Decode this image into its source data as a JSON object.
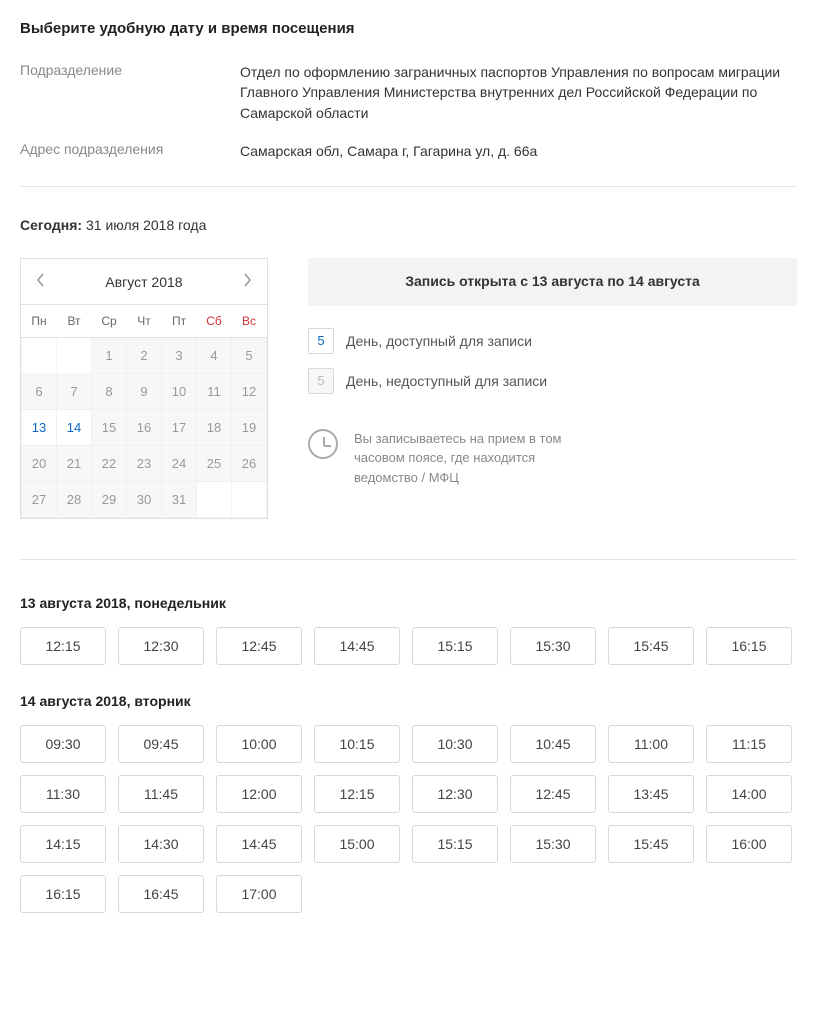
{
  "title": "Выберите удобную дату и время посещения",
  "info": {
    "dept_label": "Подразделение",
    "dept_value": "Отдел по оформлению заграничных паспортов Управления по вопросам миграции Главного Управления Министерства внутренних дел Российской Федерации по Самарской области",
    "addr_label": "Адрес подразделения",
    "addr_value": "Самарская обл, Самара г, Гагарина ул, д. 66а"
  },
  "today": {
    "label": "Сегодня:",
    "value": "31 июля 2018 года"
  },
  "calendar": {
    "month": "Август 2018",
    "weekdays": [
      "Пн",
      "Вт",
      "Ср",
      "Чт",
      "Пт",
      "Сб",
      "Вс"
    ],
    "weeks": [
      [
        {
          "d": "",
          "t": "empty"
        },
        {
          "d": "",
          "t": "empty"
        },
        {
          "d": "1",
          "t": "normal"
        },
        {
          "d": "2",
          "t": "normal"
        },
        {
          "d": "3",
          "t": "normal"
        },
        {
          "d": "4",
          "t": "normal"
        },
        {
          "d": "5",
          "t": "normal"
        }
      ],
      [
        {
          "d": "6",
          "t": "normal"
        },
        {
          "d": "7",
          "t": "normal"
        },
        {
          "d": "8",
          "t": "normal"
        },
        {
          "d": "9",
          "t": "normal"
        },
        {
          "d": "10",
          "t": "normal"
        },
        {
          "d": "11",
          "t": "normal"
        },
        {
          "d": "12",
          "t": "normal"
        }
      ],
      [
        {
          "d": "13",
          "t": "available"
        },
        {
          "d": "14",
          "t": "available"
        },
        {
          "d": "15",
          "t": "normal"
        },
        {
          "d": "16",
          "t": "normal"
        },
        {
          "d": "17",
          "t": "normal"
        },
        {
          "d": "18",
          "t": "normal"
        },
        {
          "d": "19",
          "t": "normal"
        }
      ],
      [
        {
          "d": "20",
          "t": "normal"
        },
        {
          "d": "21",
          "t": "normal"
        },
        {
          "d": "22",
          "t": "normal"
        },
        {
          "d": "23",
          "t": "normal"
        },
        {
          "d": "24",
          "t": "normal"
        },
        {
          "d": "25",
          "t": "normal"
        },
        {
          "d": "26",
          "t": "normal"
        }
      ],
      [
        {
          "d": "27",
          "t": "normal"
        },
        {
          "d": "28",
          "t": "normal"
        },
        {
          "d": "29",
          "t": "normal"
        },
        {
          "d": "30",
          "t": "normal"
        },
        {
          "d": "31",
          "t": "normal"
        },
        {
          "d": "",
          "t": "empty"
        },
        {
          "d": "",
          "t": "empty"
        }
      ]
    ]
  },
  "legend": {
    "banner": "Запись открыта с 13 августа по 14 августа",
    "avail_num": "5",
    "avail_text": "День, доступный для записи",
    "unavail_num": "5",
    "unavail_text": "День, недоступный для записи",
    "tz_note": "Вы записываетесь на прием в том часовом поясе, где находится ведомство / МФЦ"
  },
  "dates": [
    {
      "heading": "13 августа 2018, понедельник",
      "slots": [
        "12:15",
        "12:30",
        "12:45",
        "14:45",
        "15:15",
        "15:30",
        "15:45",
        "16:15"
      ]
    },
    {
      "heading": "14 августа 2018, вторник",
      "slots": [
        "09:30",
        "09:45",
        "10:00",
        "10:15",
        "10:30",
        "10:45",
        "11:00",
        "11:15",
        "11:30",
        "11:45",
        "12:00",
        "12:15",
        "12:30",
        "12:45",
        "13:45",
        "14:00",
        "14:15",
        "14:30",
        "14:45",
        "15:00",
        "15:15",
        "15:30",
        "15:45",
        "16:00",
        "16:15",
        "16:45",
        "17:00"
      ]
    }
  ]
}
